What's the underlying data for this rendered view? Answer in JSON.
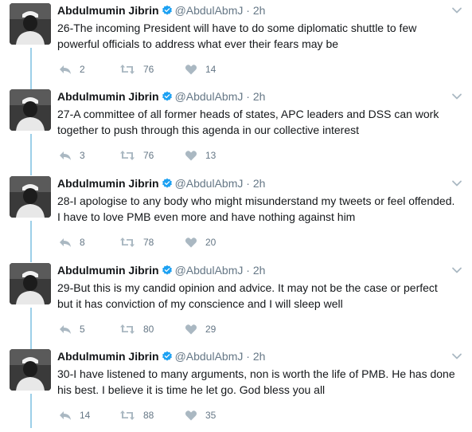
{
  "colors": {
    "accent": "#1da1f2",
    "thread_line": "#9ccfe8",
    "muted": "#657786",
    "text": "#14171a",
    "icon": "#aab8c2"
  },
  "icons": [
    "reply-icon",
    "retweet-icon",
    "like-icon",
    "verified-icon",
    "chevron-down-icon"
  ],
  "tweets": [
    {
      "name": "Abdulmumin Jibrin",
      "handle": "@AbdulAbmJ",
      "dot": "·",
      "time": "2h",
      "text": "26-The incoming President will have to do some diplomatic shuttle to few powerful officials to address what ever their fears may be",
      "replies": "2",
      "retweets": "76",
      "likes": "14"
    },
    {
      "name": "Abdulmumin Jibrin",
      "handle": "@AbdulAbmJ",
      "dot": "·",
      "time": "2h",
      "text": "27-A committee of all former heads of states, APC leaders and DSS can work together to push through this agenda in our collective interest",
      "replies": "3",
      "retweets": "76",
      "likes": "13"
    },
    {
      "name": "Abdulmumin Jibrin",
      "handle": "@AbdulAbmJ",
      "dot": "·",
      "time": "2h",
      "text": "28-I apologise to any body who might misunderstand my tweets or feel offended. I have to love PMB even more and have nothing against him",
      "replies": "8",
      "retweets": "78",
      "likes": "20"
    },
    {
      "name": "Abdulmumin Jibrin",
      "handle": "@AbdulAbmJ",
      "dot": "·",
      "time": "2h",
      "text": "29-But this is my candid opinion and advice. It may not be the case or perfect but it has conviction of my conscience and I will sleep well",
      "replies": "5",
      "retweets": "80",
      "likes": "29"
    },
    {
      "name": "Abdulmumin Jibrin",
      "handle": "@AbdulAbmJ",
      "dot": "·",
      "time": "2h",
      "text": "30-I have listened to many arguments, non is worth the life of PMB. He has done his best. I believe it is time he let go. God bless you all",
      "replies": "14",
      "retweets": "88",
      "likes": "35"
    }
  ]
}
